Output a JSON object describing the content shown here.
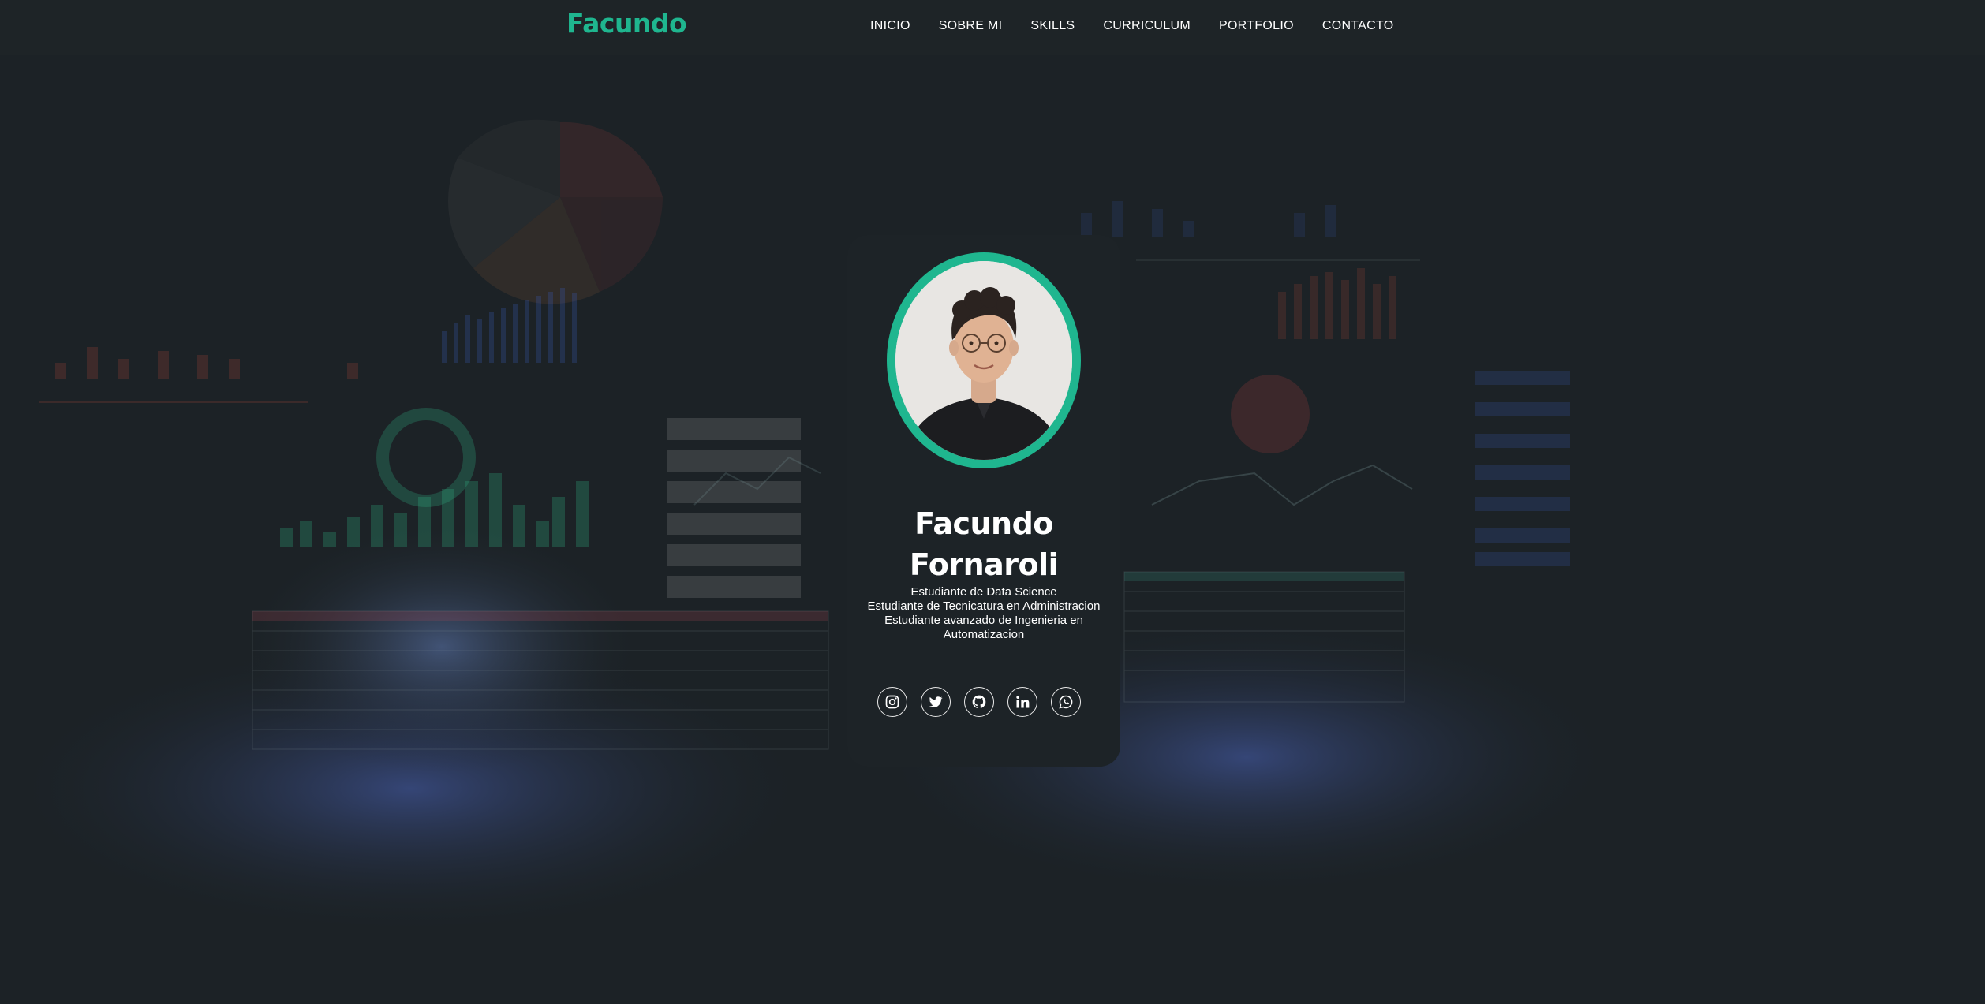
{
  "brand": {
    "logo_text": "Facundo",
    "accent_color": "#1fb68f"
  },
  "nav": {
    "items": [
      {
        "label": "INICIO"
      },
      {
        "label": "SOBRE MI"
      },
      {
        "label": "SKILLS"
      },
      {
        "label": "CURRICULUM"
      },
      {
        "label": "PORTFOLIO"
      },
      {
        "label": "CONTACTO"
      }
    ]
  },
  "profile": {
    "first_name": "Facundo",
    "last_name": "Fornaroli",
    "roles": [
      "Estudiante de Data Science",
      "Estudiante de Tecnicatura en Administracion",
      "Estudiante avanzado de Ingenieria en Automatizacion"
    ]
  },
  "socials": [
    {
      "icon": "instagram-icon"
    },
    {
      "icon": "twitter-icon"
    },
    {
      "icon": "github-icon"
    },
    {
      "icon": "linkedin-icon"
    },
    {
      "icon": "whatsapp-icon"
    }
  ]
}
